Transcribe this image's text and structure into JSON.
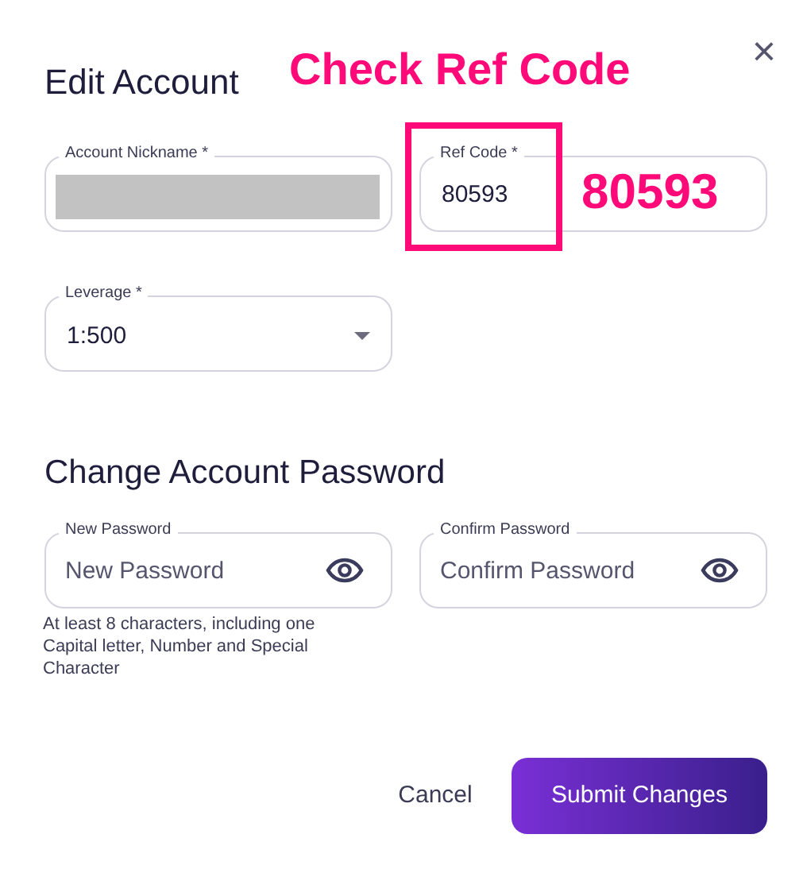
{
  "dialog": {
    "title": "Edit Account",
    "close": "×"
  },
  "account_fields": [
    {
      "label": "Account Nickname *",
      "redacted": true
    },
    {
      "label": "Ref Code *",
      "redacted": false,
      "value": "80593"
    }
  ],
  "leverage": {
    "label": "Leverage *",
    "value": "1:500"
  },
  "password_section": {
    "title": "Change Account Password",
    "fields": [
      {
        "label": "New Password",
        "placeholder": "New Password"
      },
      {
        "label": "Confirm Password",
        "placeholder": "Confirm Password"
      }
    ],
    "hint": "At least 8 characters, including one Capital letter, Number and Special Character"
  },
  "buttons": [
    {
      "label": "Cancel",
      "kind": "text"
    },
    {
      "label": "Submit Changes",
      "kind": "primary"
    }
  ],
  "annotation": {
    "title": "Check Ref Code",
    "code": "80593"
  }
}
